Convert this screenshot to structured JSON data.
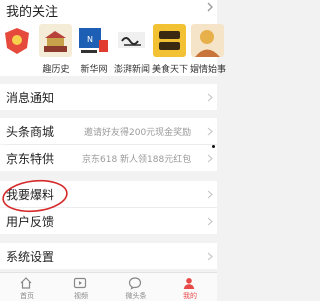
{
  "follow": {
    "title": "我的关注",
    "accounts": [
      {
        "name": "",
        "logo_text": "",
        "logo_color": "#e64a3d",
        "icon": "red-shield-logo-icon"
      },
      {
        "name": "趣历史",
        "logo_text": "趣历史",
        "logo_color": "#c7a24a",
        "icon": "history-building-logo-icon"
      },
      {
        "name": "新华网",
        "logo_text": "新华网",
        "logo_color": "#1c5fb5",
        "icon": "xinhua-news-logo-icon"
      },
      {
        "name": "澎湃新闻",
        "logo_text": "澎湃",
        "logo_color": "#2a2a2a",
        "icon": "pengpai-logo-icon"
      },
      {
        "name": "美食天下",
        "logo_text": "美食天下",
        "logo_color": "#f2c234",
        "icon": "meishi-logo-icon"
      },
      {
        "name": "媢情始事",
        "logo_text": "",
        "logo_color": "#e8b04b",
        "icon": "avatar-icon"
      }
    ]
  },
  "menu": {
    "messages": {
      "label": "消息通知"
    },
    "mall": {
      "label": "头条商城",
      "hint": "邀请好友得200元现金奖励"
    },
    "jd": {
      "label": "京东特供",
      "hint": "京东618 新人领188元红包"
    },
    "report": {
      "label": "我要爆料"
    },
    "feedback": {
      "label": "用户反馈"
    },
    "settings": {
      "label": "系统设置"
    }
  },
  "tabbar": {
    "tabs": [
      {
        "label": "首页",
        "icon": "home-icon",
        "active": false
      },
      {
        "label": "视频",
        "icon": "video-icon",
        "active": false
      },
      {
        "label": "微头条",
        "icon": "micro-headline-icon",
        "active": false
      },
      {
        "label": "我的",
        "icon": "profile-icon",
        "active": true
      }
    ]
  },
  "colors": {
    "accent": "#e84a4a",
    "annotation": "#d62a2a"
  }
}
